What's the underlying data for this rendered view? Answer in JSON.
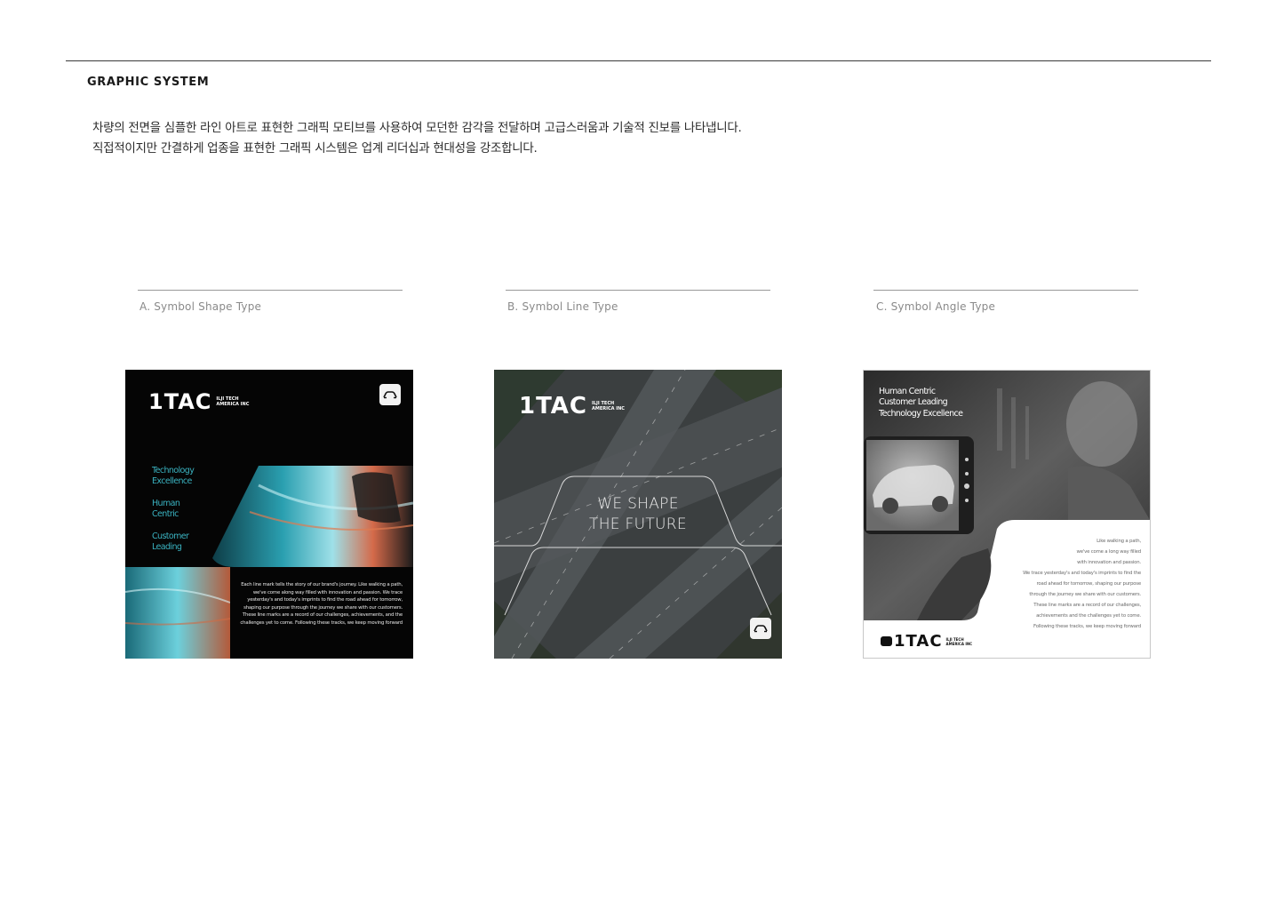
{
  "section": {
    "title": "GRAPHIC SYSTEM",
    "description_lines": [
      "차량의 전면을 심플한 라인 아트로 표현한 그래픽 모티브를 사용하여 모던한 감각을 전달하며 고급스러움과 기술적 진보를 나타냅니다.",
      "직접적이지만 간결하게 업종을 표현한 그래픽 시스템은 업계 리더십과 현대성을 강조합니다."
    ]
  },
  "columns": [
    {
      "label": "A. Symbol Shape Type"
    },
    {
      "label": "B. Symbol Line Type"
    },
    {
      "label": "C. Symbol Angle Type"
    }
  ],
  "brand": {
    "logo_text": "1TAC",
    "sub_line1": "ILJI TECH",
    "sub_line2": "AMERICA INC"
  },
  "card_a": {
    "keywords": [
      [
        "Technology",
        "Excellence"
      ],
      [
        "Human",
        "Centric"
      ],
      [
        "Customer",
        "Leading"
      ]
    ],
    "body": "Each line mark tells the story of our brand's journey. Like walking a path, we've come along way filled with innovation and passion. We trace yesterday's and today's imprints to find the road ahead for tomorrow, shaping our purpose through the journey we share with our customers. These line marks are a record of our challenges, achievements, and the challenges yet to come. Following these tracks, we keep moving forward"
  },
  "card_b": {
    "slogan_line1": "WE SHAPE",
    "slogan_line2": "THE FUTURE"
  },
  "card_c": {
    "keywords": [
      "Human Centric",
      "Customer Leading",
      "Technology Excellence"
    ],
    "body_lines": [
      "Like walking a path,",
      "we've come a long way filled",
      "with innovation and passion.",
      "We trace yesterday's and today's imprints to find the",
      "road ahead for tomorrow, shaping our purpose",
      "through the journey we share with our customers.",
      "These line marks are a record of our challenges,",
      "achievements and the challenges yet to come.",
      "Following these tracks, we keep moving forward"
    ]
  },
  "colors": {
    "accent_teal": "#3ab2c0",
    "card_dark": "#050505"
  },
  "icons": [
    "car-front-badge-icon"
  ]
}
